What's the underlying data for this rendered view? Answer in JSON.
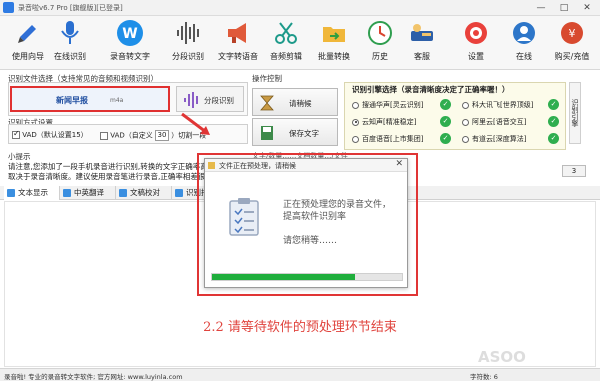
{
  "window": {
    "title": "录音啦v6.7 Pro [旗舰版][已登录]",
    "controls": [
      "—",
      "□",
      "✕"
    ]
  },
  "toolbar": {
    "items": [
      {
        "label": "使用向导",
        "icon": "guide-icon"
      },
      {
        "label": "在线识别",
        "icon": "microphone-icon"
      },
      {
        "label": "录音转文字",
        "icon": "w-logo-icon"
      },
      {
        "label": "分段识别",
        "icon": "waveform-icon"
      },
      {
        "label": "文字转语音",
        "icon": "megaphone-icon"
      },
      {
        "label": "音频剪辑",
        "icon": "scissors-icon"
      },
      {
        "label": "批量转换",
        "icon": "folder-convert-icon"
      },
      {
        "label": "历史",
        "icon": "history-icon"
      },
      {
        "label": "客服",
        "icon": "customer-service-icon"
      },
      {
        "label": "设置",
        "icon": "settings-icon"
      },
      {
        "label": "在线",
        "icon": "online-icon"
      },
      {
        "label": "购买/充值",
        "icon": "buy-icon"
      }
    ]
  },
  "file_select": {
    "group_title": "识别文件选择（支持常见的音频和视频识别）",
    "file_name": "新闻早报",
    "file_meta": "m4a",
    "segment_button": "分段识别"
  },
  "mode": {
    "group_title": "识别方式设置",
    "vad_default": "VAD（默认设置15）",
    "vad_custom": "VAD（自定义",
    "vad_value": "30",
    "vad_suffix": "）切割一段"
  },
  "actions": {
    "group_title": "操作控制",
    "start_label": "请稍候",
    "save_label": "保存文字"
  },
  "engines": {
    "title": "识别引擎选择（录音清晰度决定了正确率喔！）",
    "options": [
      {
        "label": "搜通华声[灵云识别]",
        "selected": false
      },
      {
        "label": "科大讯飞[世界顶级]",
        "selected": false
      },
      {
        "label": "云知声[精准稳定]",
        "selected": true
      },
      {
        "label": "阿里云[语音交互]",
        "selected": false
      },
      {
        "label": "百度语音[上市集团]",
        "selected": false
      },
      {
        "label": "有道云[深度算法]",
        "selected": false
      }
    ],
    "side_tab": "识别引擎"
  },
  "tips": {
    "label": "小提示",
    "text": "请注意,您添加了一段手机录音进行识别,转换的文字正确率高低取决于录音清晰度。建议使用录音笔进行录音,正确率相差很大!",
    "page": "3",
    "overlay_text": "文字/数量……文档数量…/文件"
  },
  "tabs": [
    {
      "label": "文本显示",
      "active": true
    },
    {
      "label": "中英翻译",
      "active": false
    },
    {
      "label": "文稿校对",
      "active": false
    },
    {
      "label": "识别报错",
      "active": false
    }
  ],
  "modal": {
    "title": "文件正在预处理，请稍候",
    "line1": "正在预处理您的录音文件，提高软件识别率",
    "line2": "请您稍等……",
    "progress": 0.75
  },
  "caption": "2.2 请等待软件的预处理环节结束",
  "status": {
    "left": "录音啦! 专业的录音转文字软件; 官方网址: www.luyinla.com",
    "right": "字符数:   6"
  },
  "watermark": "ASOO"
}
